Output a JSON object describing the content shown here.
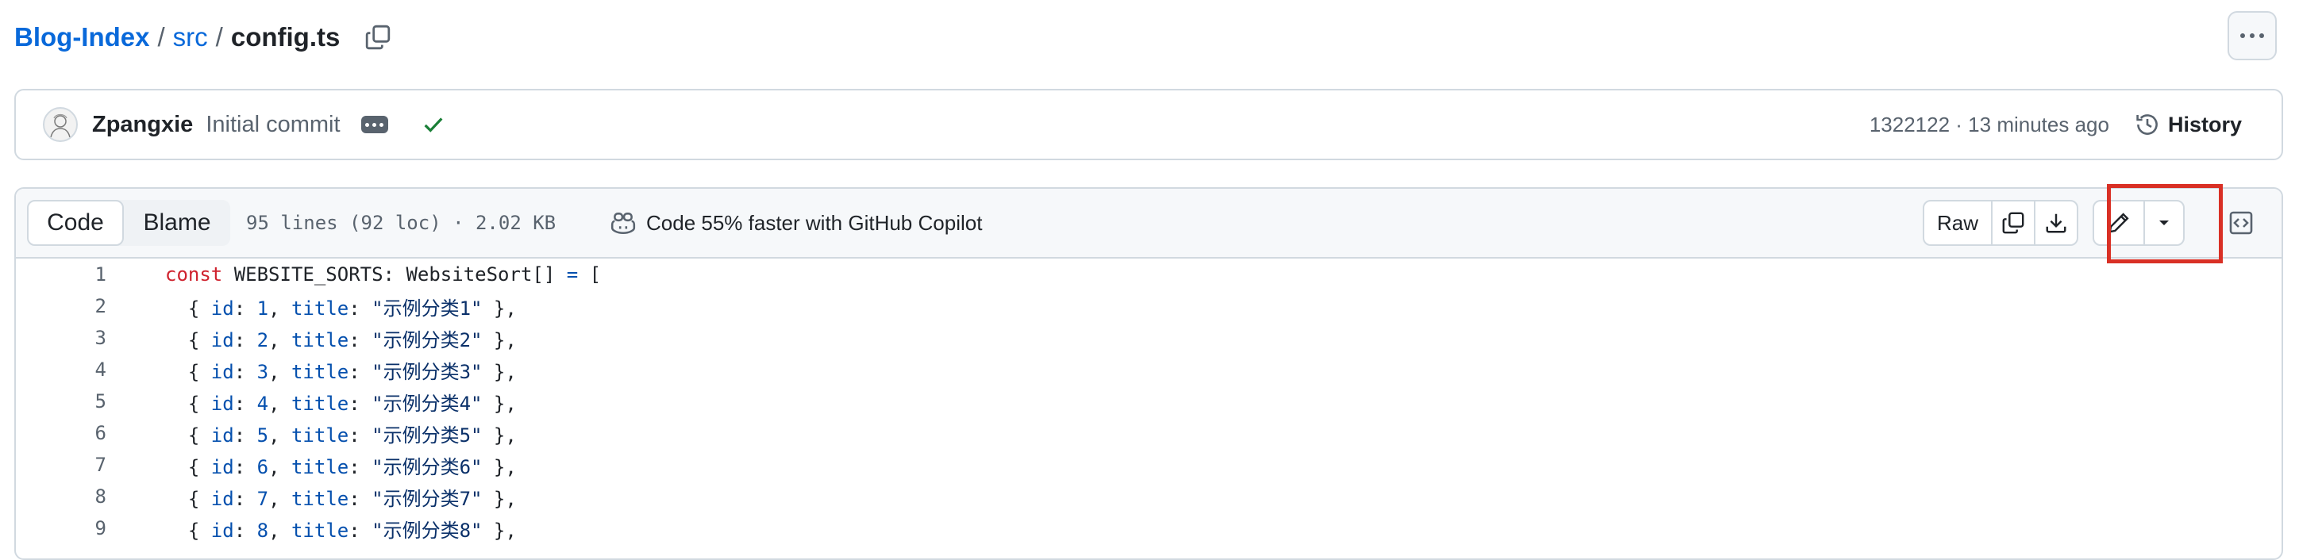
{
  "breadcrumb": {
    "repo": "Blog-Index",
    "sep1": "/",
    "dir": "src",
    "sep2": "/",
    "file": "config.ts"
  },
  "commit": {
    "author": "Zpangxie",
    "message": "Initial commit",
    "sha_time": "1322122 · 13 minutes ago",
    "history_label": "History"
  },
  "file_header": {
    "tab_code": "Code",
    "tab_blame": "Blame",
    "meta": "95 lines (92 loc) · 2.02 KB",
    "copilot_text": "Code 55% faster with GitHub Copilot",
    "raw_label": "Raw"
  },
  "code_lines": [
    {
      "n": "1",
      "parts": [
        [
          "kw",
          "const"
        ],
        [
          "t",
          " WEBSITE_SORTS"
        ],
        [
          "t",
          ": WebsiteSort[] "
        ],
        [
          "op",
          "="
        ],
        [
          "t",
          " ["
        ]
      ]
    },
    {
      "n": "2",
      "parts": [
        [
          "t",
          "  { "
        ],
        [
          "prop",
          "id"
        ],
        [
          "t",
          ": "
        ],
        [
          "num",
          "1"
        ],
        [
          "t",
          ", "
        ],
        [
          "prop",
          "title"
        ],
        [
          "t",
          ": "
        ],
        [
          "str",
          "\"示例分类1\""
        ],
        [
          "t",
          " },"
        ]
      ]
    },
    {
      "n": "3",
      "parts": [
        [
          "t",
          "  { "
        ],
        [
          "prop",
          "id"
        ],
        [
          "t",
          ": "
        ],
        [
          "num",
          "2"
        ],
        [
          "t",
          ", "
        ],
        [
          "prop",
          "title"
        ],
        [
          "t",
          ": "
        ],
        [
          "str",
          "\"示例分类2\""
        ],
        [
          "t",
          " },"
        ]
      ]
    },
    {
      "n": "4",
      "parts": [
        [
          "t",
          "  { "
        ],
        [
          "prop",
          "id"
        ],
        [
          "t",
          ": "
        ],
        [
          "num",
          "3"
        ],
        [
          "t",
          ", "
        ],
        [
          "prop",
          "title"
        ],
        [
          "t",
          ": "
        ],
        [
          "str",
          "\"示例分类3\""
        ],
        [
          "t",
          " },"
        ]
      ]
    },
    {
      "n": "5",
      "parts": [
        [
          "t",
          "  { "
        ],
        [
          "prop",
          "id"
        ],
        [
          "t",
          ": "
        ],
        [
          "num",
          "4"
        ],
        [
          "t",
          ", "
        ],
        [
          "prop",
          "title"
        ],
        [
          "t",
          ": "
        ],
        [
          "str",
          "\"示例分类4\""
        ],
        [
          "t",
          " },"
        ]
      ]
    },
    {
      "n": "6",
      "parts": [
        [
          "t",
          "  { "
        ],
        [
          "prop",
          "id"
        ],
        [
          "t",
          ": "
        ],
        [
          "num",
          "5"
        ],
        [
          "t",
          ", "
        ],
        [
          "prop",
          "title"
        ],
        [
          "t",
          ": "
        ],
        [
          "str",
          "\"示例分类5\""
        ],
        [
          "t",
          " },"
        ]
      ]
    },
    {
      "n": "7",
      "parts": [
        [
          "t",
          "  { "
        ],
        [
          "prop",
          "id"
        ],
        [
          "t",
          ": "
        ],
        [
          "num",
          "6"
        ],
        [
          "t",
          ", "
        ],
        [
          "prop",
          "title"
        ],
        [
          "t",
          ": "
        ],
        [
          "str",
          "\"示例分类6\""
        ],
        [
          "t",
          " },"
        ]
      ]
    },
    {
      "n": "8",
      "parts": [
        [
          "t",
          "  { "
        ],
        [
          "prop",
          "id"
        ],
        [
          "t",
          ": "
        ],
        [
          "num",
          "7"
        ],
        [
          "t",
          ", "
        ],
        [
          "prop",
          "title"
        ],
        [
          "t",
          ": "
        ],
        [
          "str",
          "\"示例分类7\""
        ],
        [
          "t",
          " },"
        ]
      ]
    },
    {
      "n": "9",
      "parts": [
        [
          "t",
          "  { "
        ],
        [
          "prop",
          "id"
        ],
        [
          "t",
          ": "
        ],
        [
          "num",
          "8"
        ],
        [
          "t",
          ", "
        ],
        [
          "prop",
          "title"
        ],
        [
          "t",
          ": "
        ],
        [
          "str",
          "\"示例分类8\""
        ],
        [
          "t",
          " },"
        ]
      ]
    }
  ],
  "colors": {
    "link": "#0969da",
    "highlight": "#d93025",
    "success": "#1a7f37"
  },
  "icons": [
    "copy-icon",
    "kebab-icon",
    "avatar",
    "ellipsis-icon",
    "check-icon",
    "history-icon",
    "copilot-icon",
    "download-icon",
    "pencil-icon",
    "triangle-down-icon",
    "code-square-icon"
  ]
}
